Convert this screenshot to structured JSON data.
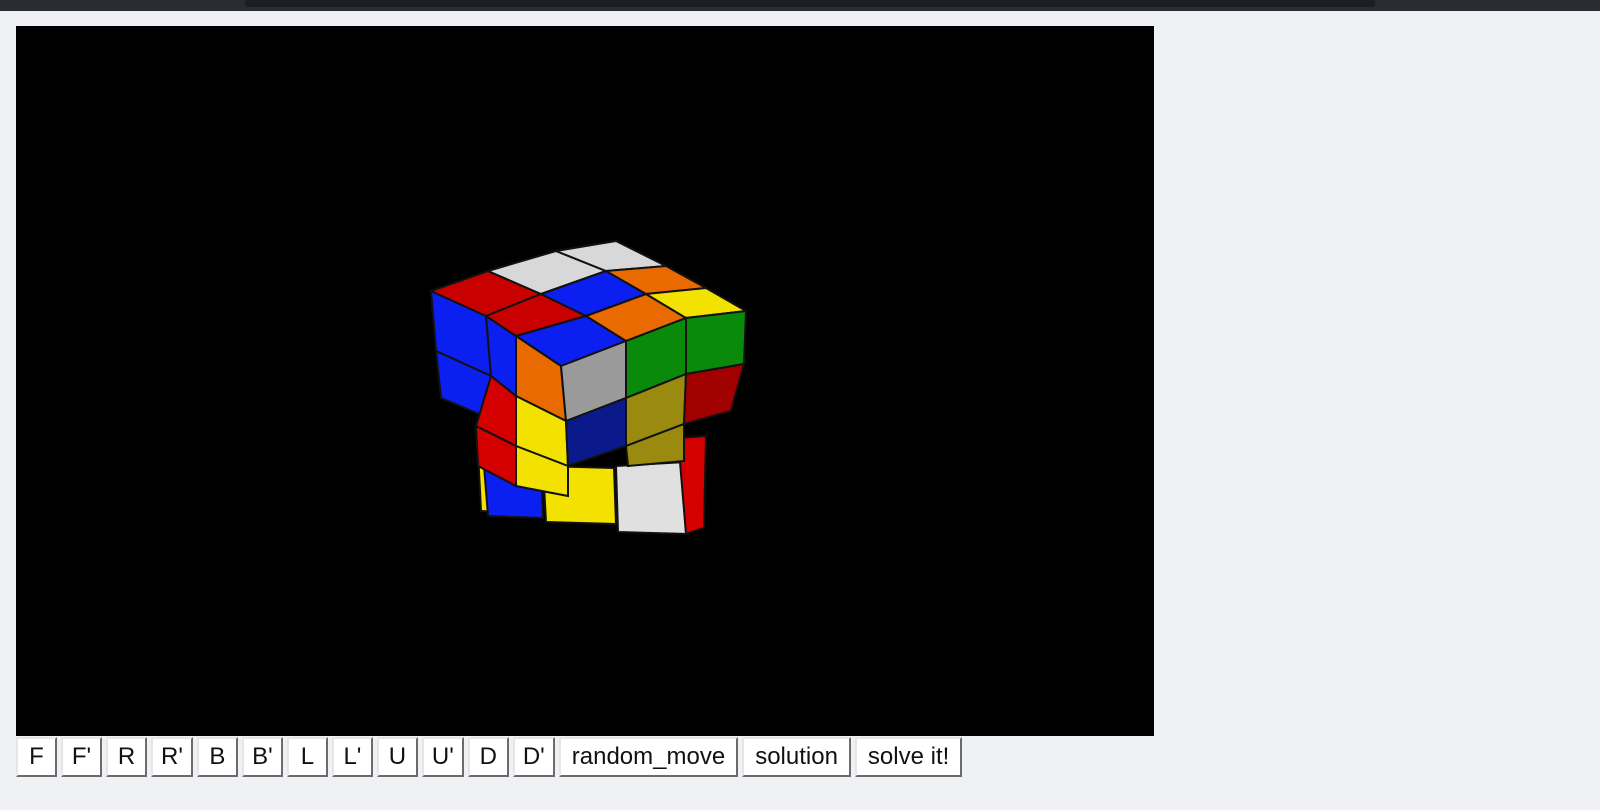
{
  "controls": {
    "buttons": [
      {
        "id": "f",
        "label": "F"
      },
      {
        "id": "f-prime",
        "label": "F'"
      },
      {
        "id": "r",
        "label": "R"
      },
      {
        "id": "r-prime",
        "label": "R'"
      },
      {
        "id": "b",
        "label": "B"
      },
      {
        "id": "b-prime",
        "label": "B'"
      },
      {
        "id": "l",
        "label": "L"
      },
      {
        "id": "l-prime",
        "label": "L'"
      },
      {
        "id": "u",
        "label": "U"
      },
      {
        "id": "u-prime",
        "label": "U'"
      },
      {
        "id": "d",
        "label": "D"
      },
      {
        "id": "d-prime",
        "label": "D'"
      },
      {
        "id": "random-move",
        "label": "random_move"
      },
      {
        "id": "solution",
        "label": "solution"
      },
      {
        "id": "solve-it",
        "label": "solve it!"
      }
    ]
  },
  "scene": {
    "background": "#000000",
    "colors": {
      "red": "#d40000",
      "blue": "#0b1ff0",
      "white": "#d8d8d8",
      "orange": "#e86a00",
      "yellow": "#f3e200",
      "green": "#0a8a0a",
      "navy": "#0a1a8a",
      "olive": "#9a8a10"
    }
  }
}
